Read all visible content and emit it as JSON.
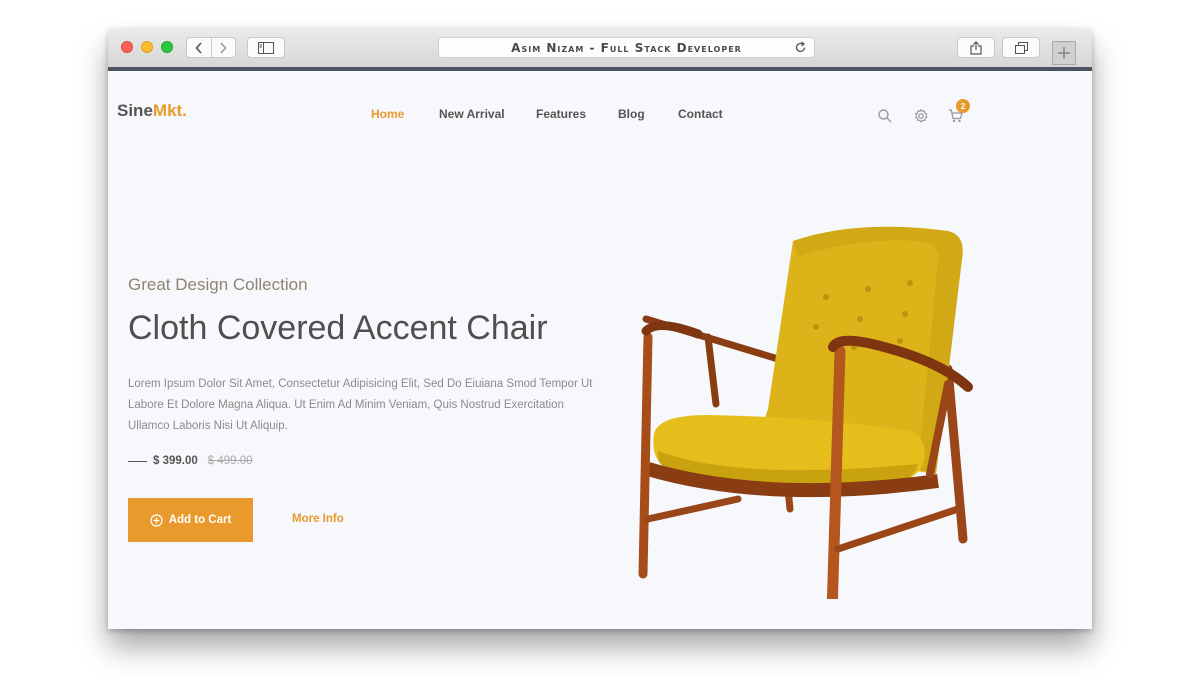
{
  "browser": {
    "address_title": "Asim Nizam - Full Stack Developer"
  },
  "site": {
    "logo_primary": "Sine",
    "logo_accent": "Mkt.",
    "accent_color": "#e89a2c",
    "nav": [
      {
        "label": "Home",
        "active": true
      },
      {
        "label": "New Arrival",
        "active": false
      },
      {
        "label": "Features",
        "active": false
      },
      {
        "label": "Blog",
        "active": false
      },
      {
        "label": "Contact",
        "active": false
      }
    ],
    "header_icons": [
      "search-icon",
      "gear-icon",
      "cart-icon"
    ],
    "cart_count": "2"
  },
  "hero": {
    "eyebrow": "Great Design Collection",
    "title": "Cloth Covered Accent Chair",
    "description": "Lorem Ipsum Dolor Sit Amet, Consectetur Adipisicing Elit, Sed Do Eiuiana Smod Tempor Ut Labore Et Dolore Magna Aliqua. Ut Enim Ad Minim Veniam, Quis Nostrud Exercitation Ullamco Laboris Nisi Ut Aliquip.",
    "price": "$ 399.00",
    "old_price": "$ 499.00",
    "add_to_cart_label": "Add to Cart",
    "more_info_label": "More Info"
  }
}
